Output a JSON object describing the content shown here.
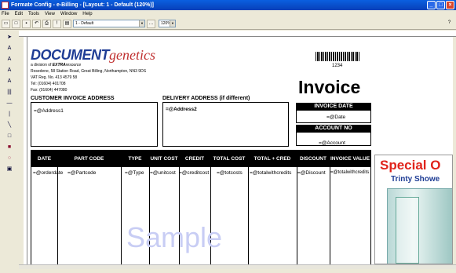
{
  "window": {
    "title": "Formate Config - e-Billing - [Layout: 1 - Default (120%)]"
  },
  "menu": [
    "File",
    "Edit",
    "Tools",
    "View",
    "Window",
    "Help"
  ],
  "toolbar": {
    "layout_combo": "1 - Default",
    "zoom_combo": "120%"
  },
  "company": {
    "logo_word1": "DOCUMENT",
    "logo_word2": "genetics",
    "division_prefix": "a division of",
    "division_brand": "EXTRA",
    "division_suffix": "resource",
    "address": "Rosedene, 58 Station Road, Great Billing, Northampton, NN3 9DS",
    "vat": "VAT Reg. No. 413 4579 58",
    "tel": "Tel: (01604) 401708",
    "fax": "Fax: (01604) 447080"
  },
  "barcode_number": "1234",
  "invoice": {
    "title": "Invoice",
    "customer_address_label": "CUSTOMER INVOICE ADDRESS",
    "customer_address_value": "=@Address1",
    "delivery_address_label": "DELIVERY ADDRESS (if different)",
    "delivery_address_value": "=@Address2",
    "date_label": "INVOICE DATE",
    "date_value": "=@Date",
    "account_label": "ACCOUNT NO",
    "account_value": "=@Account"
  },
  "table": {
    "headers": [
      "DATE",
      "PART CODE",
      "TYPE",
      "UNIT COST",
      "CREDIT",
      "TOTAL COST",
      "TOTAL + CRED",
      "DISCOUNT",
      "INVOICE VALUE"
    ],
    "row": [
      "=@orderdate",
      "=@Partcode",
      "=@Type",
      "=@unitcost",
      "=@creditcost",
      "=@totcosts",
      "=@totalwithcredits",
      "=@Discount",
      "=@totalwithcredits"
    ]
  },
  "watermark": "Sample",
  "promo": {
    "line1": "Special O",
    "line2": "Trinty Showe"
  }
}
